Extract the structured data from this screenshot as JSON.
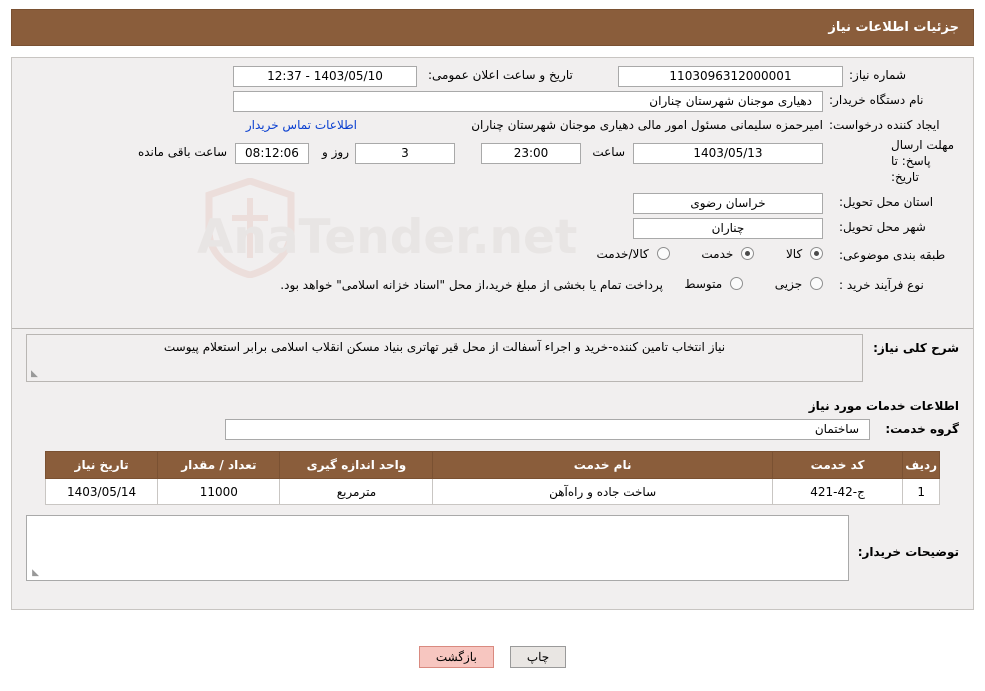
{
  "header": {
    "title": "جزئیات اطلاعات نیاز"
  },
  "form": {
    "need_number_label": "شماره نیاز:",
    "need_number_value": "1103096312000001",
    "public_announce_label": "تاریخ و ساعت اعلان عمومی:",
    "public_announce_value": "1403/05/10 - 12:37",
    "buyer_org_label": "نام دستگاه خریدار:",
    "buyer_org_value": "دهیاری موجنان  شهرستان چناران",
    "creator_label": "ایجاد کننده درخواست:",
    "creator_value": "امیرحمزه سلیمانی مسئول امور مالی دهیاری موجنان  شهرستان چناران",
    "contact_link": "اطلاعات تماس خریدار",
    "deadline_label": "مهلت ارسال پاسخ: تا تاریخ:",
    "deadline_date": "1403/05/13",
    "hour_label": "ساعت",
    "deadline_time": "23:00",
    "days_value": "3",
    "days_label": "روز و",
    "remaining_time": "08:12:06",
    "remaining_label": "ساعت باقی مانده",
    "province_label": "استان محل تحویل:",
    "province_value": "خراسان رضوی",
    "city_label": "شهر محل تحویل:",
    "city_value": "چناران",
    "category_label": "طبقه بندی موضوعی:",
    "category_options": [
      "کالا",
      "خدمت",
      "کالا/خدمت"
    ],
    "category_selected": "خدمت",
    "process_label": "نوع فرآیند خرید :",
    "process_options": [
      "جزیی",
      "متوسط"
    ],
    "process_selected": "",
    "process_note": "پرداخت تمام یا بخشی از مبلغ خرید،از محل \"اسناد خزانه اسلامی\" خواهد بود."
  },
  "watermark": {
    "text": "AnaTender.net"
  },
  "summary": {
    "label": "شرح کلی نیاز:",
    "value": "نیاز انتخاب تامین کننده-خرید و اجراء آسفالت از محل قیر تهاتری بنیاد مسکن انقلاب اسلامی برابر استعلام پیوست"
  },
  "services": {
    "section_title": "اطلاعات خدمات مورد نیاز",
    "group_label": "گروه خدمت:",
    "group_value": "ساختمان",
    "columns": [
      "ردیف",
      "کد خدمت",
      "نام خدمت",
      "واحد اندازه گیری",
      "تعداد / مقدار",
      "تاریخ نیاز"
    ],
    "rows": [
      {
        "index": "1",
        "code": "ج-42-421",
        "name": "ساخت جاده و راه‌آهن",
        "unit": "مترمربع",
        "quantity": "11000",
        "date": "1403/05/14"
      }
    ]
  },
  "buyer_notes": {
    "label": "توضیحات خریدار:",
    "value": ""
  },
  "footer": {
    "print_label": "چاپ",
    "back_label": "بازگشت"
  }
}
